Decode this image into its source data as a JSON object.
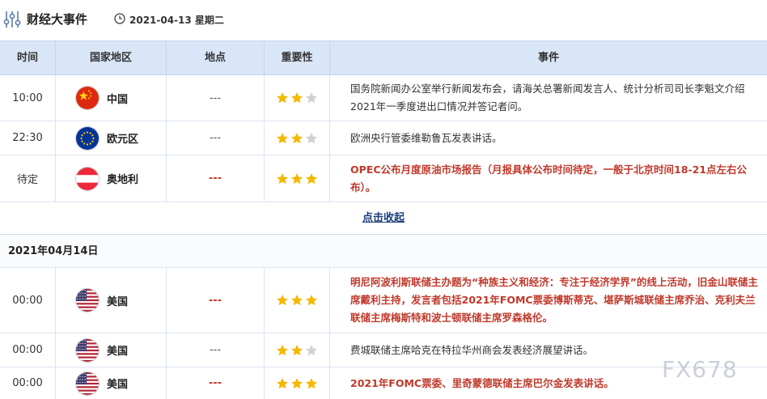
{
  "header": {
    "title": "财经大事件",
    "date": "2021-04-13 星期二"
  },
  "columns": {
    "time": "时间",
    "country": "国家地区",
    "location": "地点",
    "importance": "重要性",
    "event": "事件"
  },
  "rows_day1": [
    {
      "time": "10:00",
      "country": "中国",
      "flag": "china-flag",
      "location": "---",
      "stars": 2,
      "event": "国务院新闻办公室举行新闻发布会，请海关总署新闻发言人、统计分析司司长李魁文介绍2021年一季度进出口情况并答记者问。",
      "highlight": false
    },
    {
      "time": "22:30",
      "country": "欧元区",
      "flag": "eu-flag",
      "location": "---",
      "stars": 2,
      "event": "欧洲央行管委维勒鲁瓦发表讲话。",
      "highlight": false
    },
    {
      "time": "待定",
      "country": "奥地利",
      "flag": "austria-flag",
      "location": "---",
      "stars": 3,
      "event": "OPEC公布月度原油市场报告（月报具体公布时间待定，一般于北京时间18-21点左右公布）。",
      "highlight": true
    }
  ],
  "collapse_label": "点击收起",
  "day2_label": "2021年04月14日",
  "rows_day2": [
    {
      "time": "00:00",
      "country": "美国",
      "flag": "usa-flag",
      "location": "---",
      "stars": 3,
      "event": "明尼阿波利斯联储主办题为“种族主义和经济：专注于经济学界”的线上活动，旧金山联储主席戴利主持，发言者包括2021年FOMC票委博斯蒂克、堪萨斯城联储主席乔治、克利夫兰联储主席梅斯特和波士顿联储主席罗森格伦。",
      "highlight": true
    },
    {
      "time": "00:00",
      "country": "美国",
      "flag": "usa-flag",
      "location": "---",
      "stars": 2,
      "event": "费城联储主席哈克在特拉华州商会发表经济展望讲话。",
      "highlight": false
    },
    {
      "time": "00:00",
      "country": "美国",
      "flag": "usa-flag",
      "location": "---",
      "stars": 3,
      "event": "2021年FOMC票委、里奇蒙德联储主席巴尔金发表讲话。",
      "highlight": true
    }
  ],
  "watermark": "FX678",
  "colors": {
    "header_bg": "#d9e6f7",
    "highlight": "#c0392b",
    "star_on": "#f5b800",
    "star_off": "#d0d0d0",
    "link": "#1a3d78"
  }
}
